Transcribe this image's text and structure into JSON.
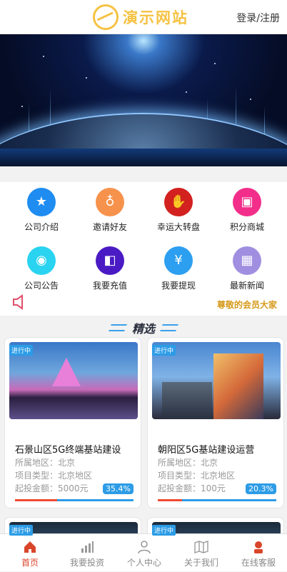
{
  "header": {
    "logo_text": "演示网站",
    "login_label": "登录/注册"
  },
  "menu": [
    {
      "label": "公司介绍",
      "icon": "medal-icon",
      "color": "#1e8cf0"
    },
    {
      "label": "邀请好友",
      "icon": "gift-icon",
      "color": "#f7924c"
    },
    {
      "label": "幸运大转盘",
      "icon": "handshake-icon",
      "color": "#d2211f"
    },
    {
      "label": "积分商城",
      "icon": "shop-icon",
      "color": "#f22e8a"
    },
    {
      "label": "公司公告",
      "icon": "android-icon",
      "color": "#2ad3f0"
    },
    {
      "label": "我要充值",
      "icon": "wallet-icon",
      "color": "#4a1bc4"
    },
    {
      "label": "我要提现",
      "icon": "yuan-icon",
      "color": "#2d9ff0"
    },
    {
      "label": "最新新闻",
      "icon": "grid-icon",
      "color": "#a08fe0"
    }
  ],
  "notice": {
    "text": "尊敬的会员大家"
  },
  "featured": {
    "title": "精选"
  },
  "cards": [
    {
      "status": "进行中",
      "title": "石景山区5G终端基站建设",
      "region": "所属地区：北京",
      "type": "项目类型：北京地区",
      "min_amount": "起投金额：5000元",
      "progress_label": "35.4%",
      "progress": 0.354
    },
    {
      "status": "进行中",
      "title": "朝阳区5G基站建设运营",
      "region": "所属地区：北京",
      "type": "项目类型：北京地区",
      "min_amount": "起投金额：100元",
      "progress_label": "20.3%",
      "progress": 0.203
    }
  ],
  "peek_cards": [
    {
      "status": "进行中"
    },
    {
      "status": "进行中"
    }
  ],
  "tabbar": [
    {
      "label": "首页",
      "icon": "home-icon",
      "active": true
    },
    {
      "label": "我要投资",
      "icon": "chart-icon",
      "active": false
    },
    {
      "label": "个人中心",
      "icon": "user-icon",
      "active": false
    },
    {
      "label": "关于我们",
      "icon": "map-icon",
      "active": false
    },
    {
      "label": "在线客服",
      "icon": "service-icon",
      "active": false
    }
  ],
  "colors": {
    "accent": "#2c9ce6",
    "active_tab": "#d9452a",
    "logo": "#f5c242",
    "progress_red": "#f04a30"
  }
}
